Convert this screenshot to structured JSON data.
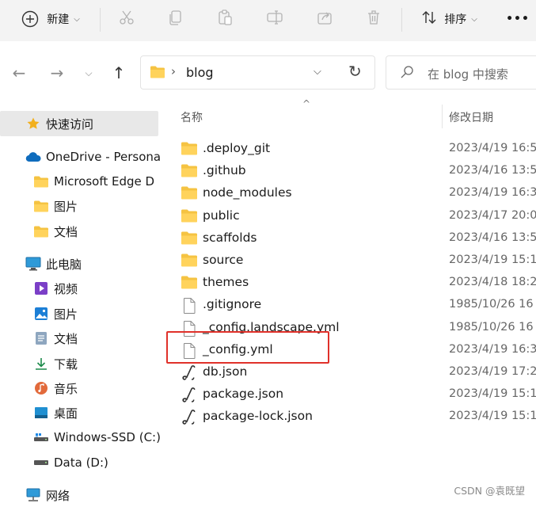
{
  "toolbar": {
    "new_label": "新建",
    "sort_label": "排序",
    "more_label": "•••"
  },
  "address": {
    "path": "blog",
    "separator": "›"
  },
  "search": {
    "placeholder": "在 blog 中搜索"
  },
  "sidebar": {
    "items": [
      {
        "label": "快速访问",
        "icon": "star-icon"
      },
      {
        "label": "OneDrive - Persona",
        "icon": "cloud-icon"
      },
      {
        "label": "Microsoft Edge D",
        "icon": "folder-icon"
      },
      {
        "label": "图片",
        "icon": "folder-icon"
      },
      {
        "label": "文档",
        "icon": "folder-icon"
      },
      {
        "label": "此电脑",
        "icon": "computer-icon"
      },
      {
        "label": "视频",
        "icon": "video-icon"
      },
      {
        "label": "图片",
        "icon": "pictures-icon"
      },
      {
        "label": "文档",
        "icon": "documents-icon"
      },
      {
        "label": "下载",
        "icon": "download-icon"
      },
      {
        "label": "音乐",
        "icon": "music-icon"
      },
      {
        "label": "桌面",
        "icon": "desktop-icon"
      },
      {
        "label": "Windows-SSD (C:)",
        "icon": "drive-icon"
      },
      {
        "label": "Data (D:)",
        "icon": "drive-icon"
      },
      {
        "label": "网络",
        "icon": "network-icon"
      }
    ]
  },
  "columns": {
    "name": "名称",
    "modified": "修改日期"
  },
  "files": [
    {
      "name": ".deploy_git",
      "date": "2023/4/19 16:5",
      "type": "folder"
    },
    {
      "name": ".github",
      "date": "2023/4/16 13:5",
      "type": "folder"
    },
    {
      "name": "node_modules",
      "date": "2023/4/19 16:3",
      "type": "folder"
    },
    {
      "name": "public",
      "date": "2023/4/17 20:0",
      "type": "folder"
    },
    {
      "name": "scaffolds",
      "date": "2023/4/16 13:5",
      "type": "folder"
    },
    {
      "name": "source",
      "date": "2023/4/19 15:1",
      "type": "folder"
    },
    {
      "name": "themes",
      "date": "2023/4/18 18:2",
      "type": "folder"
    },
    {
      "name": ".gitignore",
      "date": "1985/10/26 16",
      "type": "file"
    },
    {
      "name": "_config.landscape.yml",
      "date": "1985/10/26 16",
      "type": "file"
    },
    {
      "name": "_config.yml",
      "date": "2023/4/19 16:3",
      "type": "file"
    },
    {
      "name": "db.json",
      "date": "2023/4/19 17:2",
      "type": "json"
    },
    {
      "name": "package.json",
      "date": "2023/4/19 15:1",
      "type": "json"
    },
    {
      "name": "package-lock.json",
      "date": "2023/4/19 15:1",
      "type": "json"
    }
  ],
  "watermark": "CSDN @袁既望",
  "colors": {
    "folder": "#f5c342",
    "accent": "#0067c0",
    "highlight": "#e0312a"
  }
}
